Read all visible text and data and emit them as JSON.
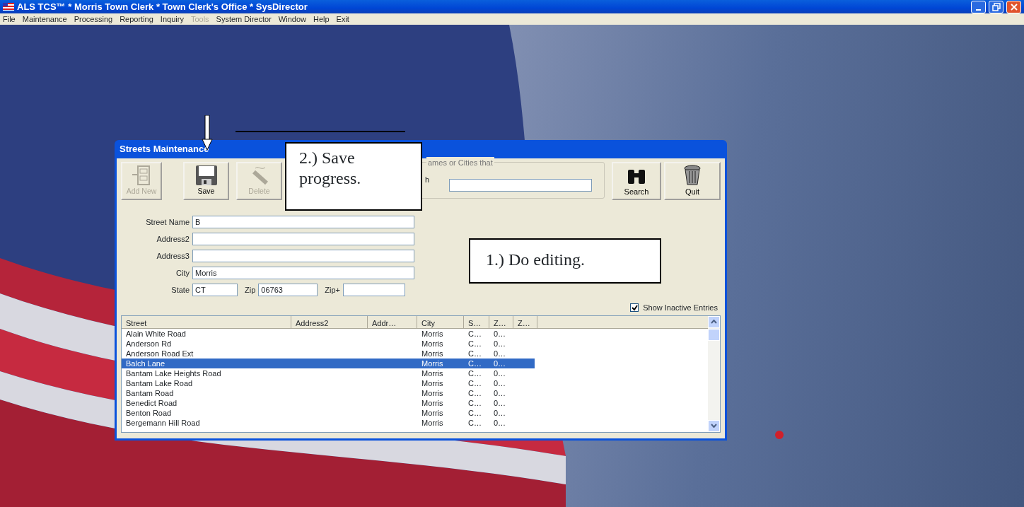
{
  "window": {
    "title": "ALS TCS™ * Morris Town Clerk * Town Clerk's Office * SysDirector"
  },
  "menu": [
    {
      "label": "File",
      "disabled": false
    },
    {
      "label": "Maintenance",
      "disabled": false
    },
    {
      "label": "Processing",
      "disabled": false
    },
    {
      "label": "Reporting",
      "disabled": false
    },
    {
      "label": "Inquiry",
      "disabled": false
    },
    {
      "label": "Tools",
      "disabled": true
    },
    {
      "label": "System Director",
      "disabled": false
    },
    {
      "label": "Window",
      "disabled": false
    },
    {
      "label": "Help",
      "disabled": false
    },
    {
      "label": "Exit",
      "disabled": false
    }
  ],
  "dialog": {
    "title": "Streets Maintenance",
    "toolbar": [
      {
        "label": "Add New",
        "kind": "add",
        "disabled": true
      },
      {
        "label": "Save",
        "kind": "save",
        "disabled": false
      },
      {
        "label": "Delete",
        "kind": "delete",
        "disabled": true
      }
    ],
    "search_group": {
      "legend": "ames or Cities that",
      "label": "h"
    },
    "actions": [
      {
        "label": "Search",
        "kind": "search"
      },
      {
        "label": "Quit",
        "kind": "quit"
      }
    ],
    "fields": [
      {
        "label": "Street Name",
        "value": "B"
      },
      {
        "label": "Address2"
      },
      {
        "label": "Address3"
      },
      {
        "label": "City",
        "value": "Morris"
      }
    ],
    "location_fields": [
      {
        "label": "State",
        "value": "CT"
      },
      {
        "label": "Zip",
        "value": "06763"
      },
      {
        "label": "Zip+"
      }
    ],
    "show_inactive": {
      "label": "Show Inactive Entries",
      "checked": true
    },
    "table": {
      "columns": [
        "Street",
        "Address2",
        "Addr…",
        "City",
        "S…",
        "Z…",
        "Z…"
      ],
      "rows": [
        {
          "street": "Alain White Road",
          "city": "Morris",
          "state": "C…",
          "zip": "0…",
          "selected": false
        },
        {
          "street": "Anderson Rd",
          "city": "Morris",
          "state": "C…",
          "zip": "0…",
          "selected": false
        },
        {
          "street": "Anderson Road Ext",
          "city": "Morris",
          "state": "C…",
          "zip": "0…",
          "selected": false
        },
        {
          "street": "Balch Lane",
          "city": "Morris",
          "state": "C…",
          "zip": "0…",
          "selected": true
        },
        {
          "street": "Bantam Lake Heights Road",
          "city": "Morris",
          "state": "C…",
          "zip": "0…",
          "selected": false
        },
        {
          "street": "Bantam Lake Road",
          "city": "Morris",
          "state": "C…",
          "zip": "0…",
          "selected": false
        },
        {
          "street": "Bantam Road",
          "city": "Morris",
          "state": "C…",
          "zip": "0…",
          "selected": false
        },
        {
          "street": "Benedict Road",
          "city": "Morris",
          "state": "C…",
          "zip": "0…",
          "selected": false
        },
        {
          "street": "Benton Road",
          "city": "Morris",
          "state": "C…",
          "zip": "0…",
          "selected": false
        },
        {
          "street": "Bergemann Hill Road",
          "city": "Morris",
          "state": "C…",
          "zip": "0…",
          "selected": false
        }
      ]
    }
  },
  "annotations": [
    {
      "kind": "save",
      "text": "2.) Save progress."
    },
    {
      "kind": "edit",
      "text": "1.) Do editing."
    }
  ]
}
